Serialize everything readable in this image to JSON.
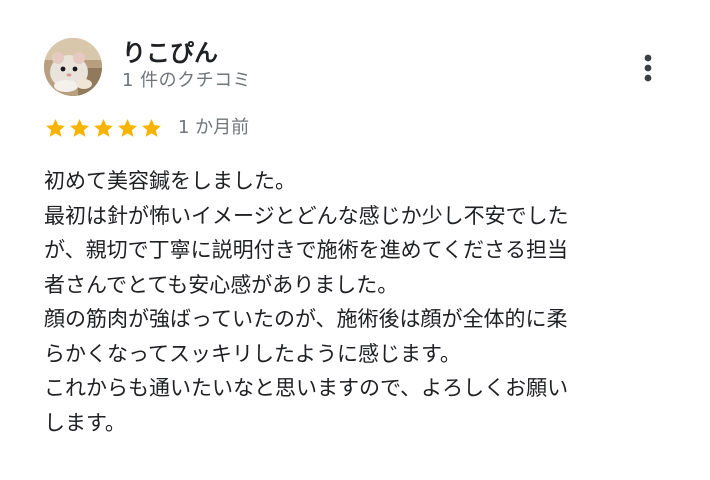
{
  "reviewer": {
    "name": "りこぴん",
    "meta": "1 件のクチコミ"
  },
  "review": {
    "rating": 5,
    "rating_max": 5,
    "date": "1 か月前",
    "lines": [
      "初めて美容鍼をしました。",
      "最初は針が怖いイメージとどんな感じか少し不安でした",
      "が、親切で丁寧に説明付きで施術を進めてくださる担当",
      "者さんでとても安心感がありました。",
      "顔の筋肉が強ばっていたのが、施術後は顔が全体的に柔",
      "らかくなってスッキリしたように感じます。",
      "これからも通いたいなと思いますので、よろしくお願い",
      "します。"
    ]
  },
  "icons": {
    "more": "more-vert-icon",
    "star": "star-icon",
    "avatar": "hamster-avatar"
  },
  "colors": {
    "star": "#F4B400",
    "text": "#202124",
    "secondary": "#70757A"
  }
}
